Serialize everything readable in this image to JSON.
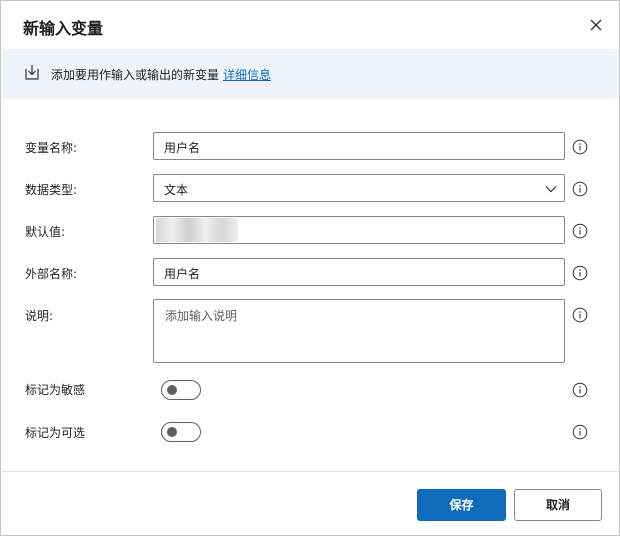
{
  "dialog": {
    "title": "新输入变量",
    "close_icon": "close-icon"
  },
  "info_bar": {
    "icon": "import-icon",
    "text": "添加要用作输入或输出的新变量",
    "link": "详细信息"
  },
  "form": {
    "variable_name": {
      "label": "变量名称:",
      "value": "用户名"
    },
    "data_type": {
      "label": "数据类型:",
      "value": "文本"
    },
    "default_value": {
      "label": "默认值:"
    },
    "external_name": {
      "label": "外部名称:",
      "value": "用户名"
    },
    "description": {
      "label": "说明:",
      "placeholder": "添加输入说明"
    },
    "sensitive": {
      "label": "标记为敏感",
      "on": false
    },
    "optional": {
      "label": "标记为可选",
      "on": false
    }
  },
  "footer": {
    "save_label": "保存",
    "cancel_label": "取消"
  },
  "colors": {
    "accent": "#0f6cbd",
    "info_bar_bg": "#eff4fc",
    "border": "#8a8886"
  }
}
